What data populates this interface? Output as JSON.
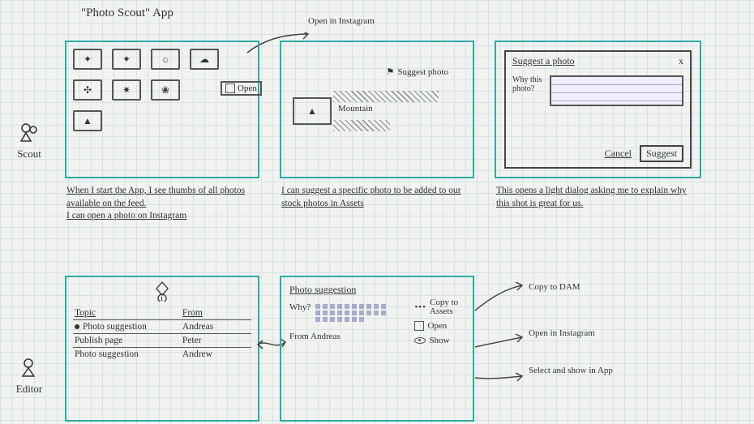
{
  "app_title": "\"Photo Scout\" App",
  "personas": {
    "scout": "Scout",
    "editor": "Editor"
  },
  "row1": {
    "open_in_instagram": "Open in Instagram",
    "f1": {
      "open_label": "Open",
      "caption": "When I start the App, I see thumbs of all photos available on the feed.\nI can open a photo on Instagram"
    },
    "f2": {
      "suggest_photo_link": "Suggest photo",
      "photo_label": "Mountain",
      "caption": "I can suggest a specific photo to be added to our stock photos in Assets"
    },
    "f3": {
      "dlg_title": "Suggest a photo",
      "why_label": "Why this photo?",
      "cancel": "Cancel",
      "suggest": "Suggest",
      "close": "x",
      "caption": "This opens a light dialog asking me to explain why this shot is great for us."
    }
  },
  "row2": {
    "f4": {
      "headers": {
        "topic": "Topic",
        "from": "From"
      },
      "rows": [
        {
          "topic": "Photo suggestion",
          "from": "Andreas",
          "unread": true
        },
        {
          "topic": "Publish page",
          "from": "Peter",
          "unread": false
        },
        {
          "topic": "Photo suggestion",
          "from": "Andrew",
          "unread": false
        }
      ],
      "badge": "1"
    },
    "f5": {
      "title": "Photo suggestion",
      "why_label": "Why?",
      "from_label": "From",
      "from_name": "Andreas",
      "actions": {
        "copy": "Copy to Assets",
        "open": "Open",
        "show": "Show"
      }
    },
    "f6": {
      "copy_to_dam": "Copy to DAM",
      "open_in_instagram": "Open in Instagram",
      "select_show": "Select and show in App"
    }
  }
}
